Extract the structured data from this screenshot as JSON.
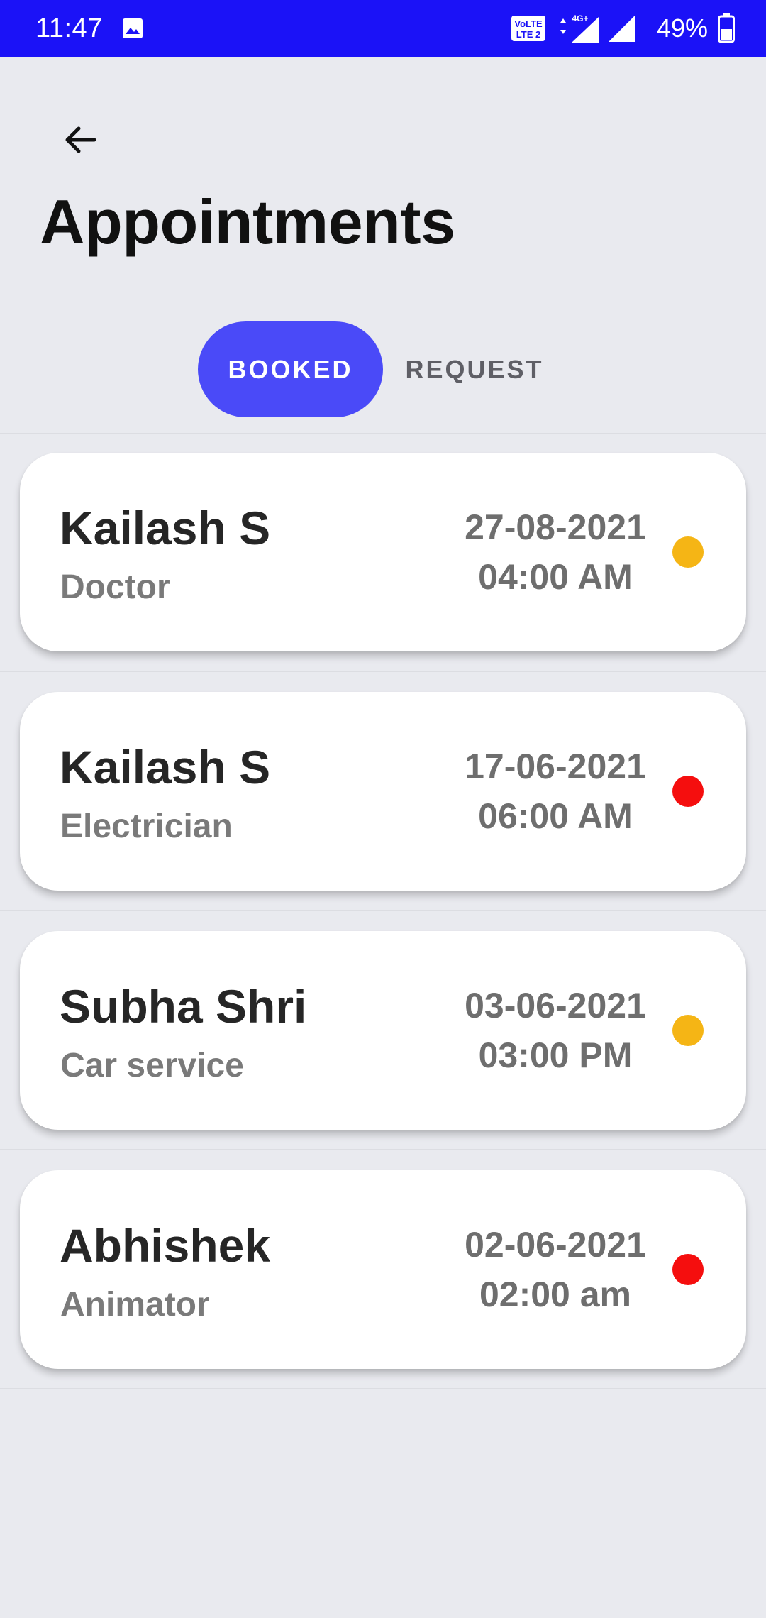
{
  "status_bar": {
    "time": "11:47",
    "gallery_icon": "gallery-icon",
    "volte_label": "VoLTE 2",
    "network": "4G+",
    "battery": "49%"
  },
  "header": {
    "back_icon": "arrow-left-icon",
    "title": "Appointments"
  },
  "tabs": [
    {
      "label": "BOOKED",
      "active": true
    },
    {
      "label": "REQUEST",
      "active": false
    }
  ],
  "colors": {
    "status_bar": "#1b12f7",
    "active_tab": "#4a4af8",
    "status_pending": "#f5b515",
    "status_cancelled": "#f50e0e"
  },
  "appointments": [
    {
      "name": "Kailash S",
      "role": "Doctor",
      "date": "27-08-2021",
      "time": "04:00 AM",
      "status_color": "#f5b515"
    },
    {
      "name": "Kailash S",
      "role": "Electrician",
      "date": "17-06-2021",
      "time": "06:00 AM",
      "status_color": "#f50e0e"
    },
    {
      "name": "Subha Shri",
      "role": "Car service",
      "date": "03-06-2021",
      "time": "03:00 PM",
      "status_color": "#f5b515"
    },
    {
      "name": "Abhishek",
      "role": "Animator",
      "date": "02-06-2021",
      "time": "02:00 am",
      "status_color": "#f50e0e"
    }
  ]
}
